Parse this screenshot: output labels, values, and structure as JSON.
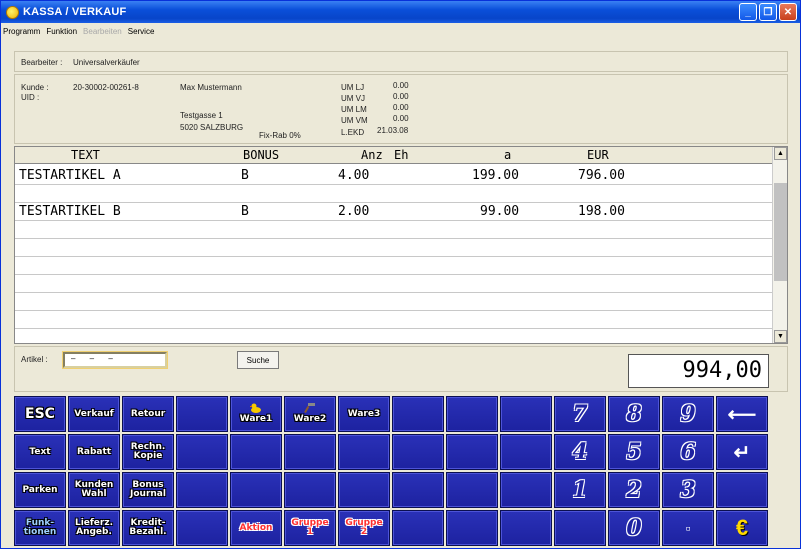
{
  "window": {
    "title": "KASSA / VERKAUF"
  },
  "menu": [
    {
      "label": "Programm",
      "enabled": true
    },
    {
      "label": "Funktion",
      "enabled": true
    },
    {
      "label": "Bearbeiten",
      "enabled": false
    },
    {
      "label": "Service",
      "enabled": true
    }
  ],
  "bearbeiter": {
    "label": "Bearbeiter :",
    "value": "Universalverkäufer"
  },
  "kunde": {
    "kunde_label": "Kunde :",
    "uid_label": "UID :",
    "number": "20-30002-00261-8",
    "name": "Max Mustermann",
    "street": "Testgasse 1",
    "city": "5020 SALZBURG",
    "fixrab": "Fix-Rab 0%",
    "stats": [
      {
        "label": "UM LJ",
        "value": "0.00"
      },
      {
        "label": "UM VJ",
        "value": "0.00"
      },
      {
        "label": "UM LM",
        "value": "0.00"
      },
      {
        "label": "UM VM",
        "value": "0.00"
      },
      {
        "label": "L.EKD",
        "value": "21.03.08"
      }
    ]
  },
  "grid": {
    "headers": {
      "text": "TEXT",
      "bonus": "BONUS",
      "anz": "Anz",
      "eh": "Eh",
      "a": "a",
      "eur": "EUR"
    },
    "rows": [
      {
        "text": "TESTARTIKEL A",
        "bonus": "B",
        "anz": "4.00",
        "a": "199.00",
        "eur": "796.00"
      },
      {
        "text": "TESTARTIKEL B",
        "bonus": "B",
        "anz": "2.00",
        "a": "99.00",
        "eur": "198.00"
      }
    ]
  },
  "artikel": {
    "label": "Artikel :",
    "value": "–    –    –",
    "search_label": "Suche"
  },
  "total": "994,00",
  "keys": {
    "esc": "ESC",
    "verkauf": "Verkauf",
    "retour": "Retour",
    "ware1": "Ware1",
    "ware2": "Ware2",
    "ware3": "Ware3",
    "d7": "7",
    "d8": "8",
    "d9": "9",
    "backspace": "⟵",
    "text": "Text",
    "rabatt": "Rabatt",
    "rechn_kopie": "Rechn. Kopie",
    "d4": "4",
    "d5": "5",
    "d6": "6",
    "enter": "↵",
    "parken": "Parken",
    "kunden_wahl": "Kunden Wahl",
    "bonus_journal": "Bonus Journal",
    "d1": "1",
    "d2": "2",
    "d3": "3",
    "funktionen": "Funk- tionen",
    "lieferschein_angebot": "Lieferz. Angeb.",
    "kredit_bezahl": "Kredit- Bezahl.",
    "aktion": "Aktion",
    "gruppe1": "Gruppe 1",
    "gruppe2": "Gruppe 2",
    "d0": "0",
    "dot": "▫",
    "euro": "€"
  }
}
